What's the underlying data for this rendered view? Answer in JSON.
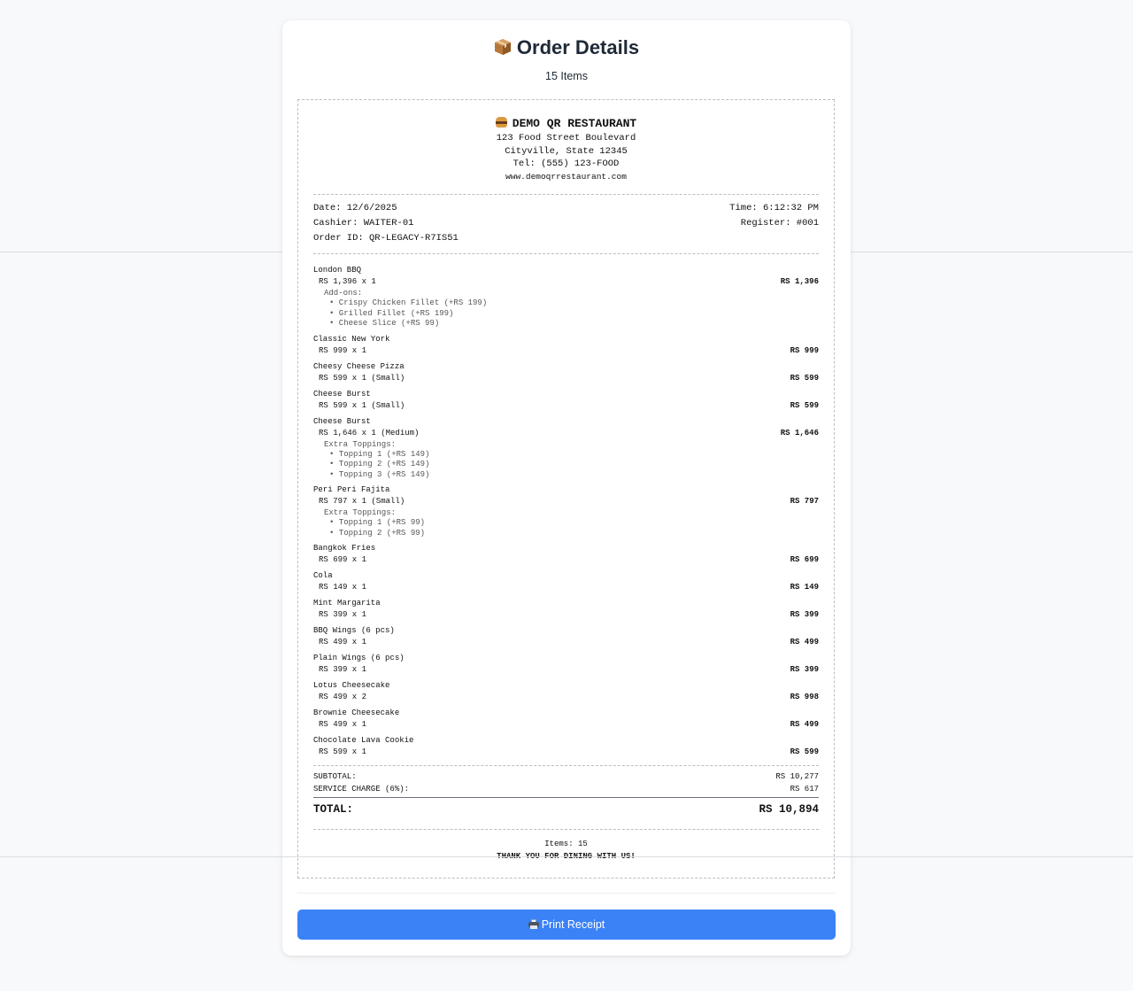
{
  "page": {
    "title": "Order Details",
    "item_count_label": "15 Items",
    "print_button_label": "Print Receipt"
  },
  "icons": {
    "title_icon": "package-icon",
    "restaurant_icon": "burger-icon",
    "print_icon": "printer-icon"
  },
  "colors": {
    "accent": "#3b82f6",
    "background": "#f8f9fb",
    "card": "#ffffff"
  },
  "restaurant": {
    "name": "DEMO QR RESTAURANT",
    "address1": "123 Food Street Boulevard",
    "address2": "Cityville, State 12345",
    "phone": "Tel: (555) 123-FOOD",
    "website": "www.demoqrrestaurant.com"
  },
  "meta": {
    "date": "Date: 12/6/2025",
    "time": "Time: 6:12:32 PM",
    "cashier": "Cashier: WAITER-01",
    "register": "Register: #001",
    "order_id": "Order ID: QR-LEGACY-R7IS51"
  },
  "items": [
    {
      "name": "London BBQ",
      "qty": "RS 1,396 x 1",
      "price": "RS 1,396",
      "mod_label": "Add-ons:",
      "mods": [
        "• Crispy Chicken Fillet (+RS 199)",
        "• Grilled Fillet (+RS 199)",
        "• Cheese Slice (+RS 99)"
      ]
    },
    {
      "name": "Classic New York",
      "qty": "RS 999 x 1",
      "price": "RS 999"
    },
    {
      "name": "Cheesy Cheese Pizza",
      "qty": "RS 599 x 1 (Small)",
      "price": "RS 599"
    },
    {
      "name": "Cheese Burst",
      "qty": "RS 599 x 1 (Small)",
      "price": "RS 599"
    },
    {
      "name": "Cheese Burst",
      "qty": "RS 1,646 x 1 (Medium)",
      "price": "RS 1,646",
      "mod_label": "Extra Toppings:",
      "mods": [
        "• Topping 1 (+RS 149)",
        "• Topping 2 (+RS 149)",
        "• Topping 3 (+RS 149)"
      ]
    },
    {
      "name": "Peri Peri Fajita",
      "qty": "RS 797 x 1 (Small)",
      "price": "RS 797",
      "mod_label": "Extra Toppings:",
      "mods": [
        "• Topping 1 (+RS 99)",
        "• Topping 2 (+RS 99)"
      ]
    },
    {
      "name": "Bangkok Fries",
      "qty": "RS 699 x 1",
      "price": "RS 699"
    },
    {
      "name": "Cola",
      "qty": "RS 149 x 1",
      "price": "RS 149"
    },
    {
      "name": "Mint Margarita",
      "qty": "RS 399 x 1",
      "price": "RS 399"
    },
    {
      "name": "BBQ Wings (6 pcs)",
      "qty": "RS 499 x 1",
      "price": "RS 499"
    },
    {
      "name": "Plain Wings (6 pcs)",
      "qty": "RS 399 x 1",
      "price": "RS 399"
    },
    {
      "name": "Lotus Cheesecake",
      "qty": "RS 499 x 2",
      "price": "RS 998"
    },
    {
      "name": "Brownie Cheesecake",
      "qty": "RS 499 x 1",
      "price": "RS 499"
    },
    {
      "name": "Chocolate Lava Cookie",
      "qty": "RS 599 x 1",
      "price": "RS 599"
    }
  ],
  "totals": {
    "subtotal_label": "SUBTOTAL:",
    "subtotal_value": "RS 10,277",
    "service_label": "SERVICE CHARGE (6%):",
    "service_value": "RS 617",
    "total_label": "TOTAL:",
    "total_value": "RS 10,894"
  },
  "footer": {
    "items": "Items: 15",
    "thanks": "THANK YOU FOR DINING WITH US!"
  }
}
